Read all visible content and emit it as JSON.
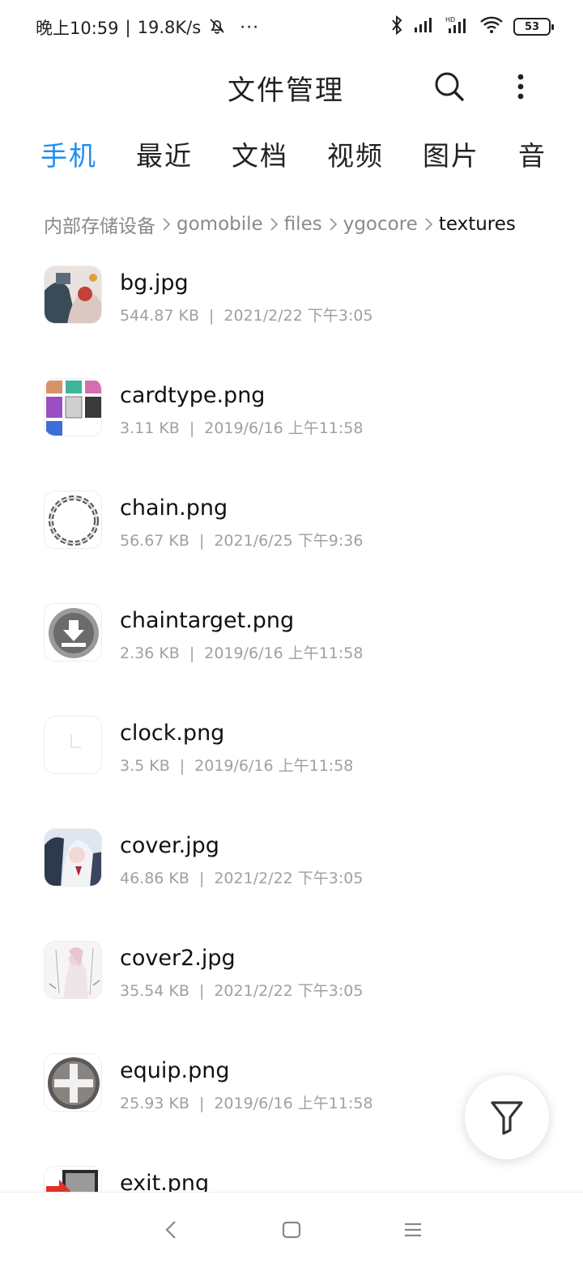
{
  "status_bar": {
    "time": "晚上10:59",
    "speed": "19.8K/s",
    "battery": "53",
    "overflow": "···",
    "icons": [
      "mute-bell-icon",
      "bluetooth-icon",
      "signal-icon",
      "hd-signal-icon",
      "wifi-icon",
      "battery-icon"
    ]
  },
  "header": {
    "title": "文件管理",
    "icons": [
      "search-icon",
      "more-vert-icon"
    ]
  },
  "tabs": [
    {
      "label": "手机",
      "active": true
    },
    {
      "label": "最近",
      "active": false
    },
    {
      "label": "文档",
      "active": false
    },
    {
      "label": "视频",
      "active": false
    },
    {
      "label": "图片",
      "active": false
    },
    {
      "label": "音",
      "active": false
    }
  ],
  "breadcrumb": [
    "内部存储设备",
    "gomobile",
    "files",
    "ygocore",
    "textures"
  ],
  "files": [
    {
      "name": "bg.jpg",
      "size": "544.87 KB",
      "date": "2021/2/22 下午3:05",
      "icon": "image-thumbnail"
    },
    {
      "name": "cardtype.png",
      "size": "3.11 KB",
      "date": "2019/6/16 上午11:58",
      "icon": "image-thumbnail"
    },
    {
      "name": "chain.png",
      "size": "56.67 KB",
      "date": "2021/6/25 下午9:36",
      "icon": "image-thumbnail"
    },
    {
      "name": "chaintarget.png",
      "size": "2.36 KB",
      "date": "2019/6/16 上午11:58",
      "icon": "image-thumbnail"
    },
    {
      "name": "clock.png",
      "size": "3.5 KB",
      "date": "2019/6/16 上午11:58",
      "icon": "image-thumbnail"
    },
    {
      "name": "cover.jpg",
      "size": "46.86 KB",
      "date": "2021/2/22 下午3:05",
      "icon": "image-thumbnail"
    },
    {
      "name": "cover2.jpg",
      "size": "35.54 KB",
      "date": "2021/2/22 下午3:05",
      "icon": "image-thumbnail"
    },
    {
      "name": "equip.png",
      "size": "25.93 KB",
      "date": "2019/6/16 上午11:58",
      "icon": "image-thumbnail"
    },
    {
      "name": "exit.png",
      "size": "",
      "date": "",
      "icon": "image-thumbnail"
    }
  ],
  "fab": {
    "icon": "filter-icon"
  },
  "nav_bar": {
    "icons": [
      "back-icon",
      "home-icon",
      "recents-icon"
    ]
  },
  "colors": {
    "accent": "#1c8ef3",
    "text": "#111111",
    "meta": "#a0a0a0",
    "breadcrumb": "#8a8a8a"
  }
}
